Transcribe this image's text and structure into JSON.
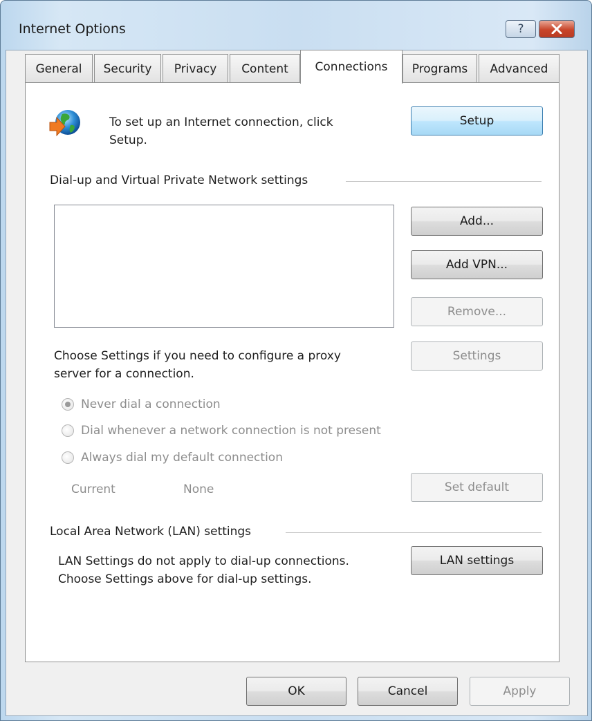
{
  "window": {
    "title": "Internet Options",
    "help_glyph": "?"
  },
  "tabs": [
    {
      "label": "General",
      "active": false
    },
    {
      "label": "Security",
      "active": false
    },
    {
      "label": "Privacy",
      "active": false
    },
    {
      "label": "Content",
      "active": false
    },
    {
      "label": "Connections",
      "active": true
    },
    {
      "label": "Programs",
      "active": false
    },
    {
      "label": "Advanced",
      "active": false
    }
  ],
  "setup": {
    "icon": "globe-arrow-icon",
    "text_line1": "To set up an Internet connection, click",
    "text_line2": "Setup.",
    "button": "Setup"
  },
  "dialup": {
    "group_label": "Dial-up and Virtual Private Network settings",
    "list_items": [],
    "add_button": "Add...",
    "add_vpn_button": "Add VPN...",
    "remove_button": "Remove...",
    "proxy_text_line1": "Choose Settings if you need to configure a proxy",
    "proxy_text_line2": "server for a connection.",
    "settings_button": "Settings",
    "radios": [
      {
        "label": "Never dial a connection",
        "checked": true
      },
      {
        "label": "Dial whenever a network connection is not present",
        "checked": false
      },
      {
        "label": "Always dial my default connection",
        "checked": false
      }
    ],
    "current_label": "Current",
    "current_value": "None",
    "set_default_button": "Set default"
  },
  "lan": {
    "group_label": "Local Area Network (LAN) settings",
    "text_line1": "LAN Settings do not apply to dial-up connections.",
    "text_line2": "Choose Settings above for dial-up settings.",
    "button": "LAN settings"
  },
  "footer": {
    "ok": "OK",
    "cancel": "Cancel",
    "apply": "Apply"
  }
}
